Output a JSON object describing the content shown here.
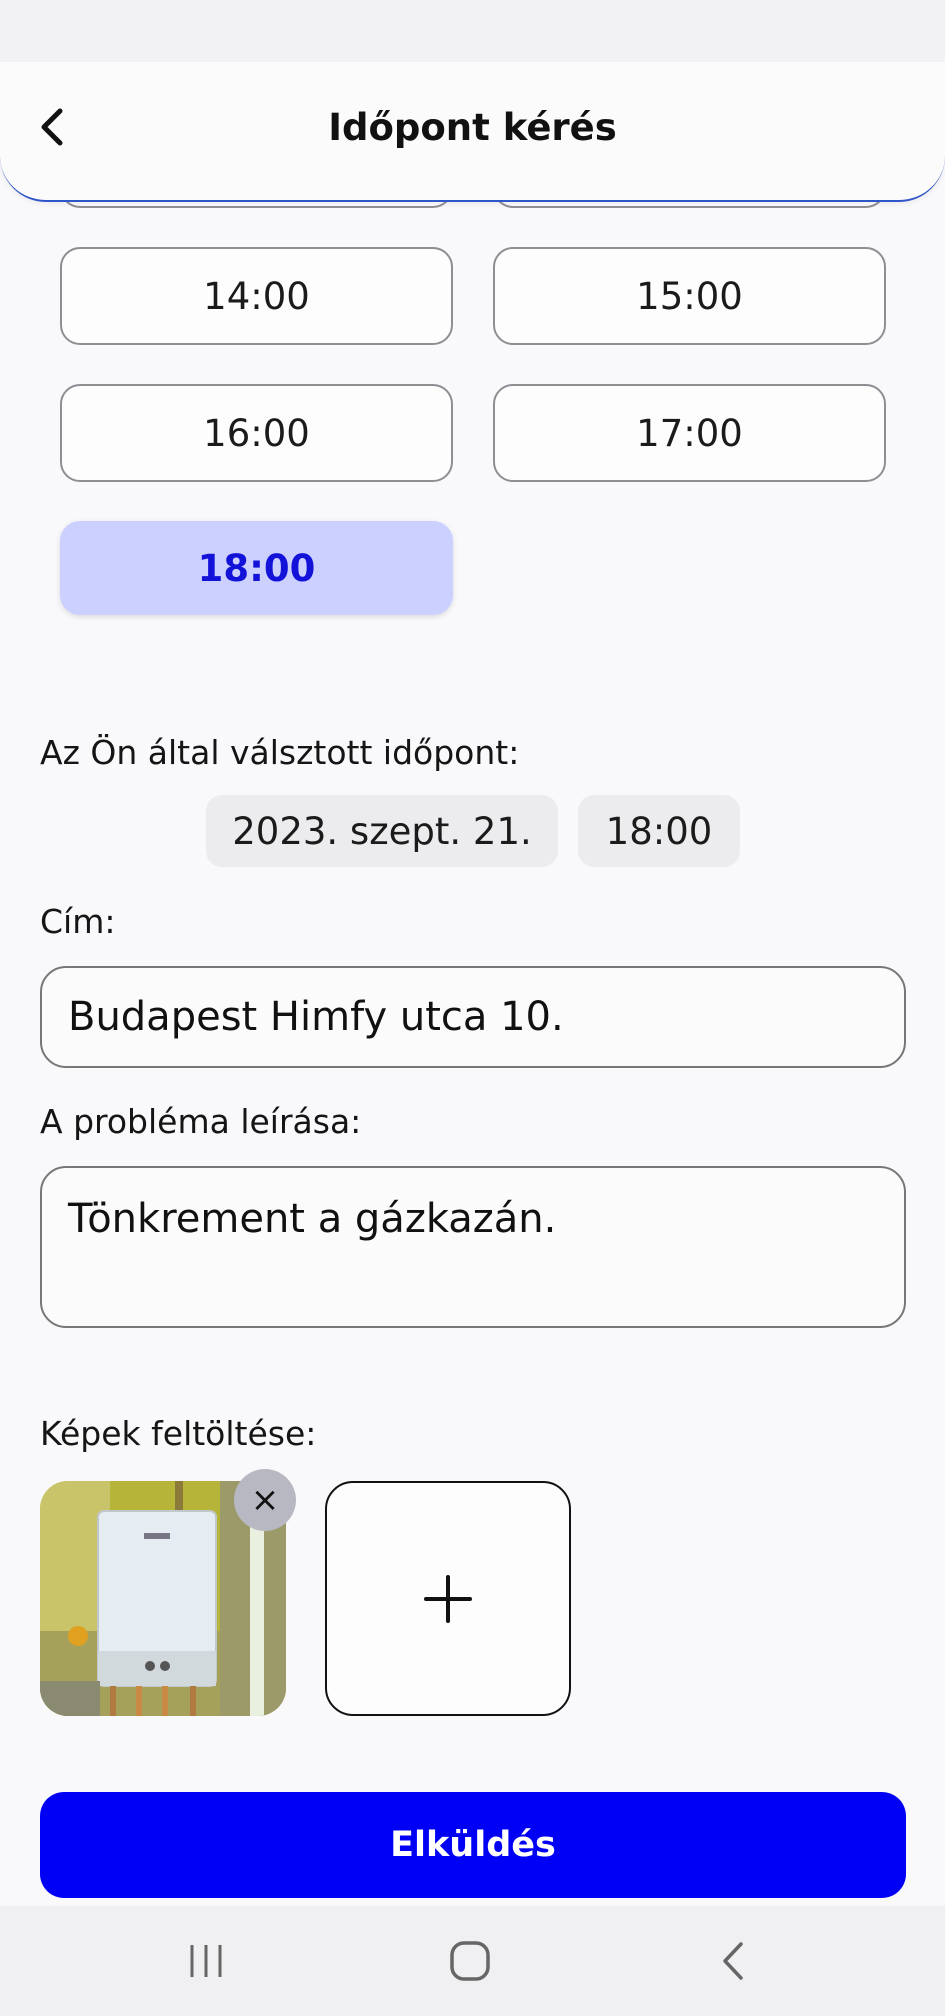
{
  "header": {
    "title": "Időpont kérés"
  },
  "time_slots": [
    {
      "label": "14:00",
      "selected": false
    },
    {
      "label": "15:00",
      "selected": false
    },
    {
      "label": "16:00",
      "selected": false
    },
    {
      "label": "17:00",
      "selected": false
    },
    {
      "label": "18:00",
      "selected": true
    }
  ],
  "selection": {
    "label": "Az Ön által válsztott időpont:",
    "date": "2023. szept. 21.",
    "time": "18:00"
  },
  "address": {
    "label": "Cím:",
    "value": "Budapest Himfy utca 10."
  },
  "problem": {
    "label": "A probléma leírása:",
    "value": "Tönkrement a gázkazán."
  },
  "images": {
    "label": "Képek feltöltése:",
    "remove_icon": "×"
  },
  "submit": {
    "label": "Elküldés"
  },
  "colors": {
    "accent": "#0000f5",
    "selected_slot_bg": "#ccd0ff",
    "selected_slot_text": "#1212d8"
  }
}
